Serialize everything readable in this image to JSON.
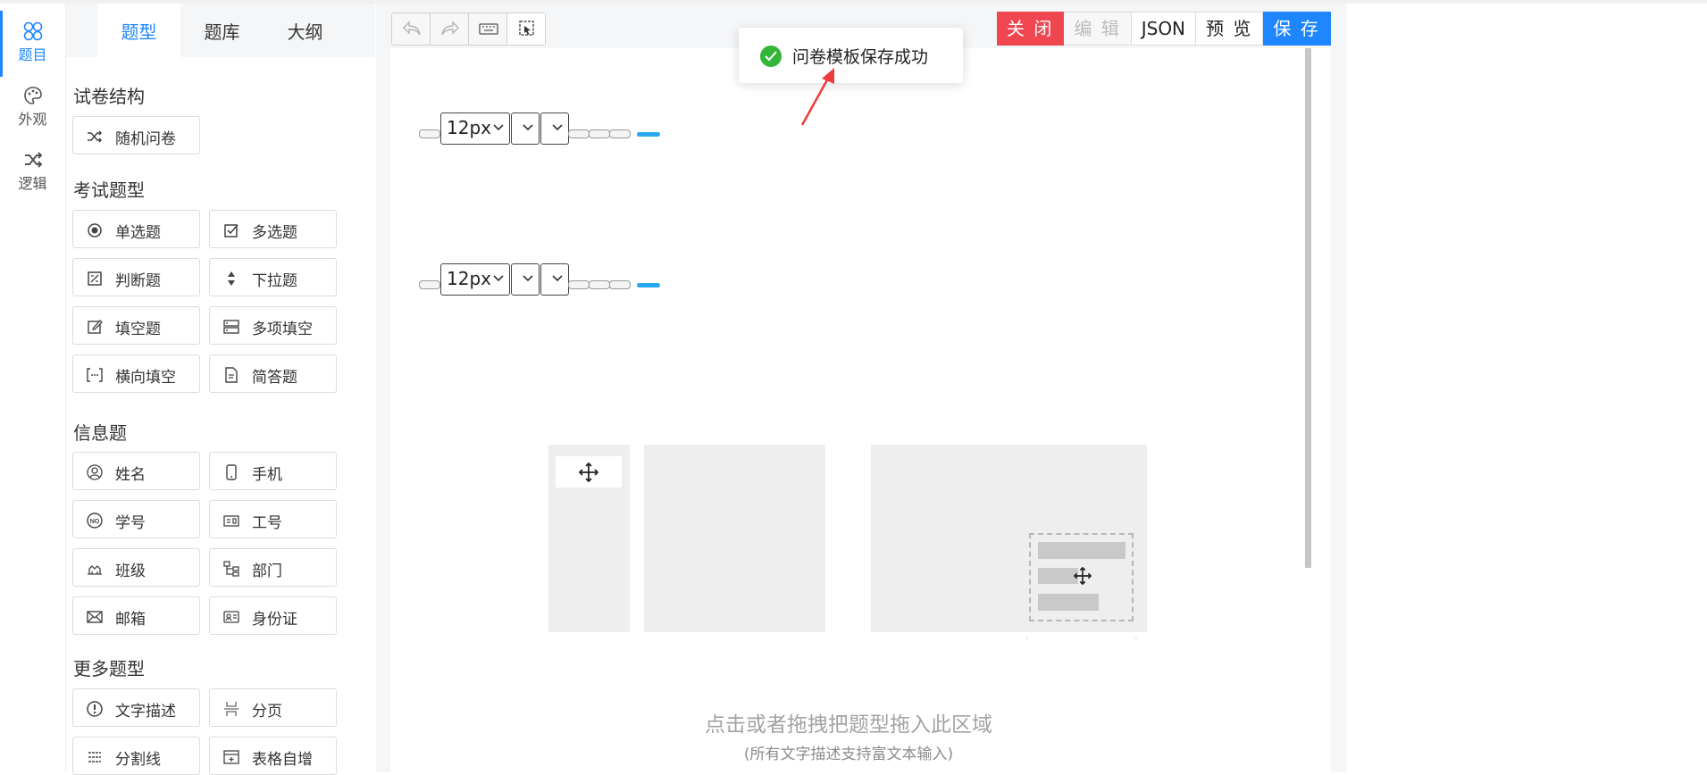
{
  "rail": {
    "items": [
      {
        "label": "题目",
        "icon": "circles-icon",
        "active": true
      },
      {
        "label": "外观",
        "icon": "palette-icon",
        "active": false
      },
      {
        "label": "逻辑",
        "icon": "shuffle-icon",
        "active": false
      }
    ]
  },
  "panel": {
    "tabs": [
      {
        "label": "题型",
        "active": true
      },
      {
        "label": "题库",
        "active": false
      },
      {
        "label": "大纲",
        "active": false
      }
    ],
    "sections": {
      "structure": {
        "title": "试卷结构",
        "items": [
          {
            "label": "随机问卷",
            "icon": "shuffle-icon"
          }
        ]
      },
      "exam": {
        "title": "考试题型",
        "items": [
          {
            "label": "单选题",
            "icon": "radio-icon"
          },
          {
            "label": "多选题",
            "icon": "checkbox-icon"
          },
          {
            "label": "判断题",
            "icon": "judge-icon"
          },
          {
            "label": "下拉题",
            "icon": "dropdown-arrows-icon"
          },
          {
            "label": "填空题",
            "icon": "edit-icon"
          },
          {
            "label": "多项填空",
            "icon": "multi-fill-icon"
          },
          {
            "label": "横向填空",
            "icon": "bracket-fill-icon"
          },
          {
            "label": "简答题",
            "icon": "document-icon"
          }
        ]
      },
      "info": {
        "title": "信息题",
        "items": [
          {
            "label": "姓名",
            "icon": "user-icon"
          },
          {
            "label": "手机",
            "icon": "phone-icon"
          },
          {
            "label": "学号",
            "icon": "number-icon"
          },
          {
            "label": "工号",
            "icon": "id-card-icon"
          },
          {
            "label": "班级",
            "icon": "class-icon"
          },
          {
            "label": "部门",
            "icon": "org-icon"
          },
          {
            "label": "邮箱",
            "icon": "mail-icon"
          },
          {
            "label": "身份证",
            "icon": "identity-icon"
          }
        ]
      },
      "more": {
        "title": "更多题型",
        "items": [
          {
            "label": "文字描述",
            "icon": "info-icon"
          },
          {
            "label": "分页",
            "icon": "page-break-icon"
          },
          {
            "label": "分割线",
            "icon": "divider-icon"
          },
          {
            "label": "表格自增",
            "icon": "table-add-icon"
          }
        ]
      }
    }
  },
  "toolbar": {
    "icons": [
      "undo-icon",
      "redo-icon",
      "keyboard-icon",
      "select-icon"
    ]
  },
  "actions": {
    "close": "关 闭",
    "edit": "编 辑",
    "json": "JSON",
    "preview": "预 览",
    "save": "保 存"
  },
  "toast": {
    "message": "问卷模板保存成功",
    "status": "success",
    "color": "#33b53a"
  },
  "editor": {
    "font_size_1": "12px",
    "font_size_2": "12px",
    "empty_title": "点击或者拖拽把题型拖入此区域",
    "empty_subtitle": "(所有文字描述支持富文本输入)"
  },
  "colors": {
    "accent": "#1e86ff",
    "danger": "#f0464f",
    "highlight": "#27a7ef"
  }
}
